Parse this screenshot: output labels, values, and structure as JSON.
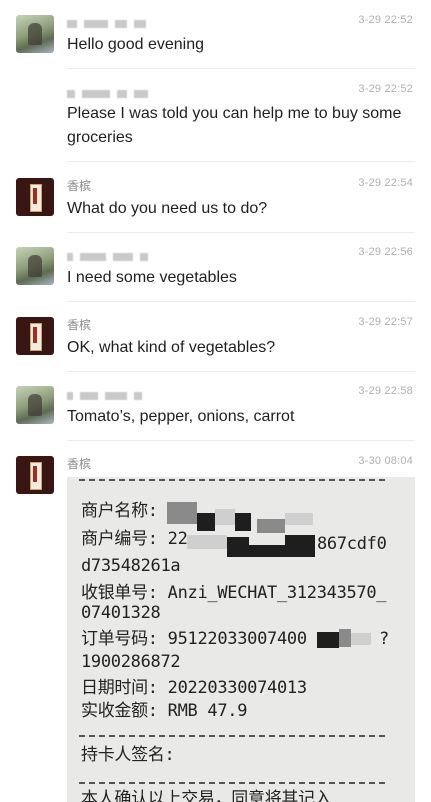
{
  "messages": [
    {
      "sender": "",
      "sender_obscured": true,
      "time": "3-29 22:52",
      "text": "Hello good evening",
      "avatar": "user-photo-avatar"
    },
    {
      "sender": "",
      "sender_obscured": true,
      "time": "3-29 22:52",
      "text": "Please I was told you can help me to buy some groceries",
      "avatar": "user-photo-avatar"
    },
    {
      "sender": "香槟",
      "sender_obscured": false,
      "time": "3-29 22:54",
      "text": "What do you need us to do?",
      "avatar": "shop-avatar"
    },
    {
      "sender": "",
      "sender_obscured": true,
      "time": "3-29 22:56",
      "text": "I need some vegetables",
      "avatar": "user-photo-avatar"
    },
    {
      "sender": "香槟",
      "sender_obscured": false,
      "time": "3-29 22:57",
      "text": "OK, what kind of vegetables?",
      "avatar": "shop-avatar"
    },
    {
      "sender": "",
      "sender_obscured": true,
      "time": "3-29 22:58",
      "text": "Tomato’s, pepper, onions, carrot",
      "avatar": "user-photo-avatar"
    },
    {
      "sender": "香槟",
      "sender_obscured": false,
      "time": "3-30 08:04",
      "text": "",
      "avatar": "shop-avatar"
    }
  ],
  "receipt": {
    "merchant_name": "商户名称:",
    "merchant_no_label": "商户编号: 22",
    "merchant_no_tail": "867cdf0",
    "merchant_no_line2": "d73548261a",
    "cashier_label": "收银单号: Anzi_WECHAT_312343570_",
    "cashier_line2": "07401328",
    "order_label": "订单号码: 95122033007400",
    "order_tail": "?",
    "order_line2": "1900286872",
    "date_label": "日期时间: 20220330074013",
    "amount_label": "实收金额: RMB 47.9",
    "signature_label": "持卡人签名:",
    "bottom_line": "本人确认以上交易，同意将其记入"
  }
}
